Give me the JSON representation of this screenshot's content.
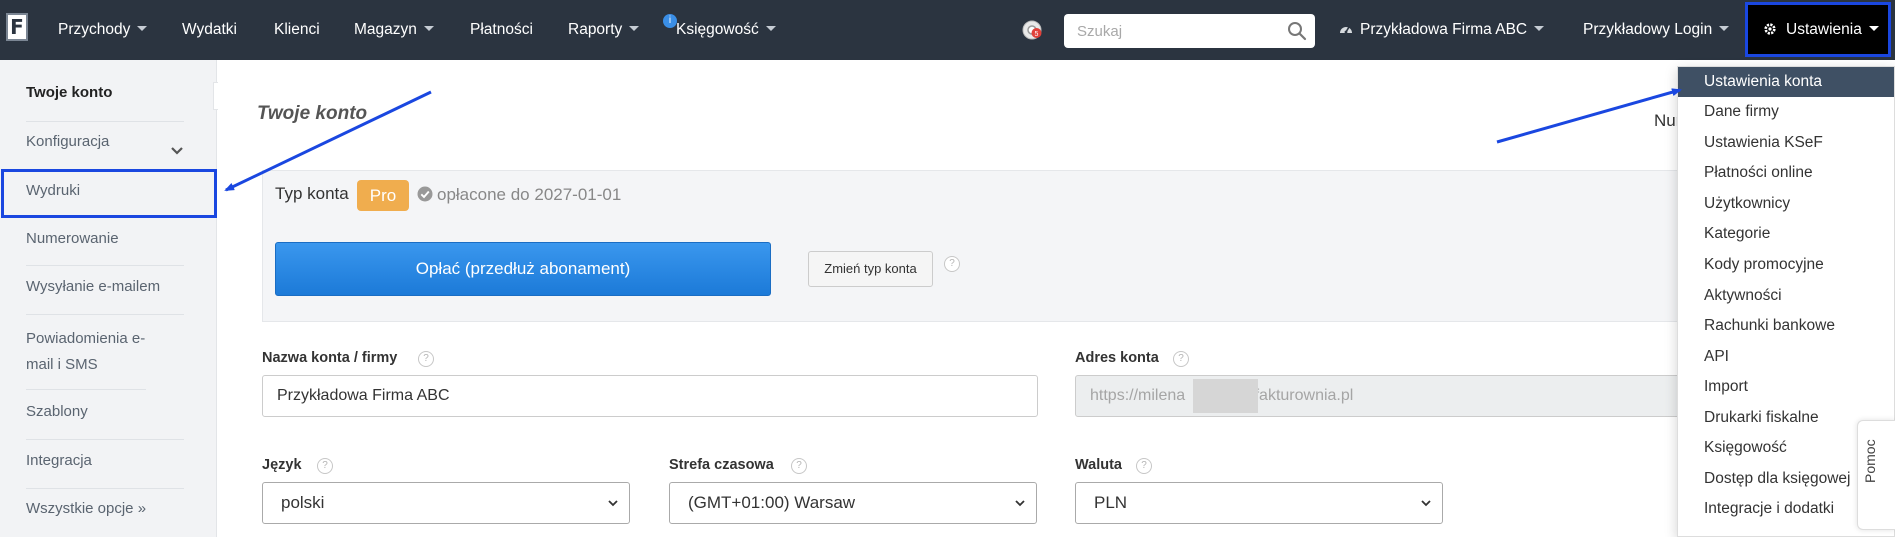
{
  "nav": {
    "logo": "F",
    "items": [
      {
        "label": "Przychody",
        "caret": true
      },
      {
        "label": "Wydatki",
        "caret": false
      },
      {
        "label": "Klienci",
        "caret": false
      },
      {
        "label": "Magazyn",
        "caret": true
      },
      {
        "label": "Płatności",
        "caret": false
      },
      {
        "label": "Raporty",
        "caret": true
      },
      {
        "label": "Księgowość",
        "caret": true
      }
    ],
    "ksiegowosc_badge": "i",
    "notification_count": "5",
    "search_placeholder": "Szukaj",
    "company": "Przykładowa Firma ABC",
    "login": "Przykładowy Login",
    "settings": "Ustawienia"
  },
  "sidebar": {
    "items": [
      {
        "label": "Twoje konto",
        "active": true
      },
      {
        "label": "Konfiguracja",
        "expandable": true
      },
      {
        "label": "Wydruki"
      },
      {
        "label": "Numerowanie"
      },
      {
        "label": "Wysyłanie e-mailem"
      },
      {
        "label": "Powiadomienia e-mail i SMS"
      },
      {
        "label": "Szablony"
      },
      {
        "label": "Integracja"
      },
      {
        "label": "Wszystkie opcje »"
      }
    ]
  },
  "main": {
    "title": "Twoje konto",
    "cut_text": "Nun",
    "account_type_label": "Typ konta",
    "plan_badge": "Pro",
    "paid_until": "opłacone do 2027-01-01",
    "pay_button": "Opłać (przedłuż abonament)",
    "change_type_button": "Zmień typ konta",
    "help_mark": "?",
    "fields": {
      "name_label": "Nazwa konta / firmy",
      "name_value": "Przykładowa Firma ABC",
      "address_label": "Adres konta",
      "address_prefix": "https://milena",
      "address_suffix": ".fakturownia.pl",
      "language_label": "Język",
      "language_value": "polski",
      "timezone_label": "Strefa czasowa",
      "timezone_value": "(GMT+01:00) Warsaw",
      "currency_label": "Waluta",
      "currency_value": "PLN"
    }
  },
  "settings_menu": {
    "items": [
      {
        "label": "Ustawienia konta",
        "active": true
      },
      {
        "label": "Dane firmy"
      },
      {
        "label": "Ustawienia KSeF"
      },
      {
        "label": "Płatności online"
      },
      {
        "label": "Użytkownicy"
      },
      {
        "label": "Kategorie"
      },
      {
        "label": "Kody promocyjne"
      },
      {
        "label": "Aktywności"
      },
      {
        "label": "Rachunki bankowe"
      },
      {
        "label": "API"
      },
      {
        "label": "Import"
      },
      {
        "label": "Drukarki fiskalne"
      },
      {
        "label": "Księgowość"
      },
      {
        "label": "Dostęp dla księgowej"
      },
      {
        "label": "Integracje i dodatki"
      }
    ]
  },
  "help_tab": "Pomoc",
  "colors": {
    "navbar": "#2b3440",
    "highlight": "#1a47e0",
    "pro_badge": "#f0ad4e",
    "pay_button": "#2688e3",
    "menu_active": "#3f5064"
  }
}
